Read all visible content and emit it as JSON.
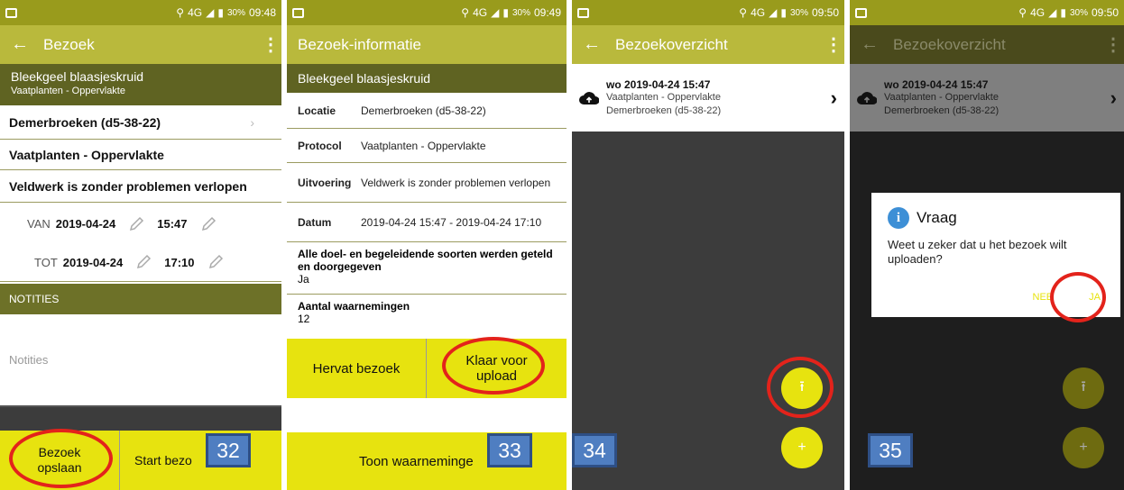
{
  "status": {
    "s1": {
      "battery": "30%",
      "time": "09:48",
      "net": "4G"
    },
    "s2": {
      "battery": "30%",
      "time": "09:49",
      "net": "4G"
    },
    "s3": {
      "battery": "30%",
      "time": "09:50",
      "net": "4G"
    },
    "s4": {
      "battery": "30%",
      "time": "09:50",
      "net": "4G"
    }
  },
  "screen1": {
    "title": "Bezoek",
    "species": "Bleekgeel blaasjeskruid",
    "subtitle": "Vaatplanten - Oppervlakte",
    "location": "Demerbroeken (d5-38-22)",
    "protocol": "Vaatplanten - Oppervlakte",
    "execution": "Veldwerk is zonder problemen verlopen",
    "from_label": "VAN",
    "from_date": "2019-04-24",
    "from_time": "15:47",
    "to_label": "TOT",
    "to_date": "2019-04-24",
    "to_time": "17:10",
    "notes_header": "NOTITIES",
    "notes_placeholder": "Notities",
    "save_button": "Bezoek opslaan",
    "start_button": "Start bezo",
    "badge": "32"
  },
  "screen2": {
    "title": "Bezoek-informatie",
    "species": "Bleekgeel blaasjeskruid",
    "rows": [
      {
        "key": "Locatie",
        "value": "Demerbroeken (d5-38-22)"
      },
      {
        "key": "Protocol",
        "value": "Vaatplanten - Oppervlakte"
      },
      {
        "key": "Uitvoering",
        "value": "Veldwerk is zonder problemen verlopen"
      },
      {
        "key": "Datum",
        "value": "2019-04-24 15:47 - 2019-04-24 17:10"
      }
    ],
    "all_species_label": "Alle doel- en begeleidende soorten werden geteld en doorgegeven",
    "all_species_value": "Ja",
    "observations_label": "Aantal waarnemingen",
    "observations_value": "12",
    "resume_button": "Hervat bezoek",
    "ready_button": "Klaar voor upload",
    "show_button": "Toon waarneminge",
    "badge": "33"
  },
  "screen3": {
    "title": "Bezoekoverzicht",
    "visit_date": "wo 2019-04-24 15:47",
    "visit_protocol": "Vaatplanten - Oppervlakte",
    "visit_location": "Demerbroeken (d5-38-22)",
    "badge": "34"
  },
  "screen4": {
    "title": "Bezoekoverzicht",
    "visit_date": "wo 2019-04-24 15:47",
    "visit_protocol": "Vaatplanten - Oppervlakte",
    "visit_location": "Demerbroeken (d5-38-22)",
    "dialog_title": "Vraag",
    "dialog_message": "Weet u zeker dat u het bezoek wilt uploaden?",
    "dialog_no": "NEE",
    "dialog_yes": "JA",
    "badge": "35"
  },
  "colors": {
    "appbar": "#b9b93c",
    "dark": "#5f6322",
    "accent": "#e7e30f",
    "highlight": "#e3231b",
    "badge": "#4f7ec1"
  }
}
